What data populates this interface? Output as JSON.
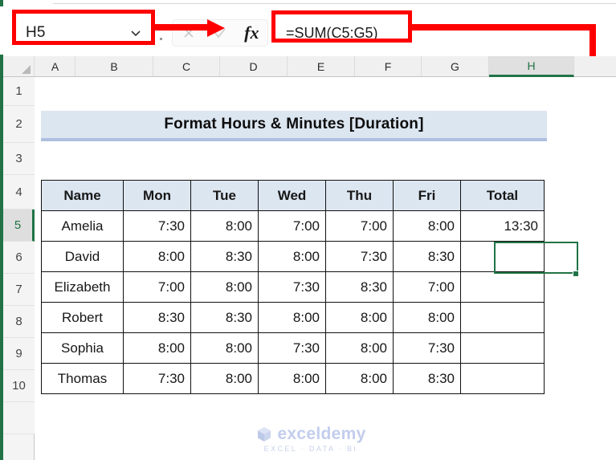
{
  "formula_bar": {
    "name_box": {
      "value": "H5",
      "chevron_icon": "chevron-down-icon"
    },
    "cancel_icon": "cancel-x-icon",
    "enter_icon": "enter-check-icon",
    "function_icon": "fx-insert-function-icon",
    "formula": "=SUM(C5:G5)"
  },
  "grid": {
    "columns": [
      "A",
      "B",
      "C",
      "D",
      "E",
      "F",
      "G",
      "H"
    ],
    "selected_column": "H",
    "rows": [
      "1",
      "2",
      "3",
      "4",
      "5",
      "6",
      "7",
      "8",
      "9",
      "10"
    ],
    "selected_row": "5",
    "active_cell": "H5"
  },
  "banner": {
    "title": "Format Hours & Minutes [Duration]"
  },
  "table": {
    "headers": [
      "Name",
      "Mon",
      "Tue",
      "Wed",
      "Thu",
      "Fri",
      "Total"
    ],
    "rows": [
      {
        "name": "Amelia",
        "mon": "7:30",
        "tue": "8:00",
        "wed": "7:00",
        "thu": "7:00",
        "fri": "8:00",
        "total": "13:30"
      },
      {
        "name": "David",
        "mon": "8:00",
        "tue": "8:30",
        "wed": "8:00",
        "thu": "7:30",
        "fri": "8:30",
        "total": ""
      },
      {
        "name": "Elizabeth",
        "mon": "7:00",
        "tue": "8:00",
        "wed": "7:30",
        "thu": "8:30",
        "fri": "7:00",
        "total": ""
      },
      {
        "name": "Robert",
        "mon": "8:30",
        "tue": "8:30",
        "wed": "8:00",
        "thu": "8:00",
        "fri": "8:00",
        "total": ""
      },
      {
        "name": "Sophia",
        "mon": "8:00",
        "tue": "8:00",
        "wed": "7:30",
        "thu": "8:00",
        "fri": "7:30",
        "total": ""
      },
      {
        "name": "Thomas",
        "mon": "7:30",
        "tue": "8:00",
        "wed": "8:00",
        "thu": "8:00",
        "fri": "8:30",
        "total": ""
      }
    ]
  },
  "watermark": {
    "name": "exceldemy",
    "tagline": "EXCEL · DATA · BI",
    "logo_icon": "cube-logo-icon"
  },
  "annotation": {
    "color": "#fe0000",
    "selection_color": "#217346",
    "banner_color": "#dce6f1"
  }
}
